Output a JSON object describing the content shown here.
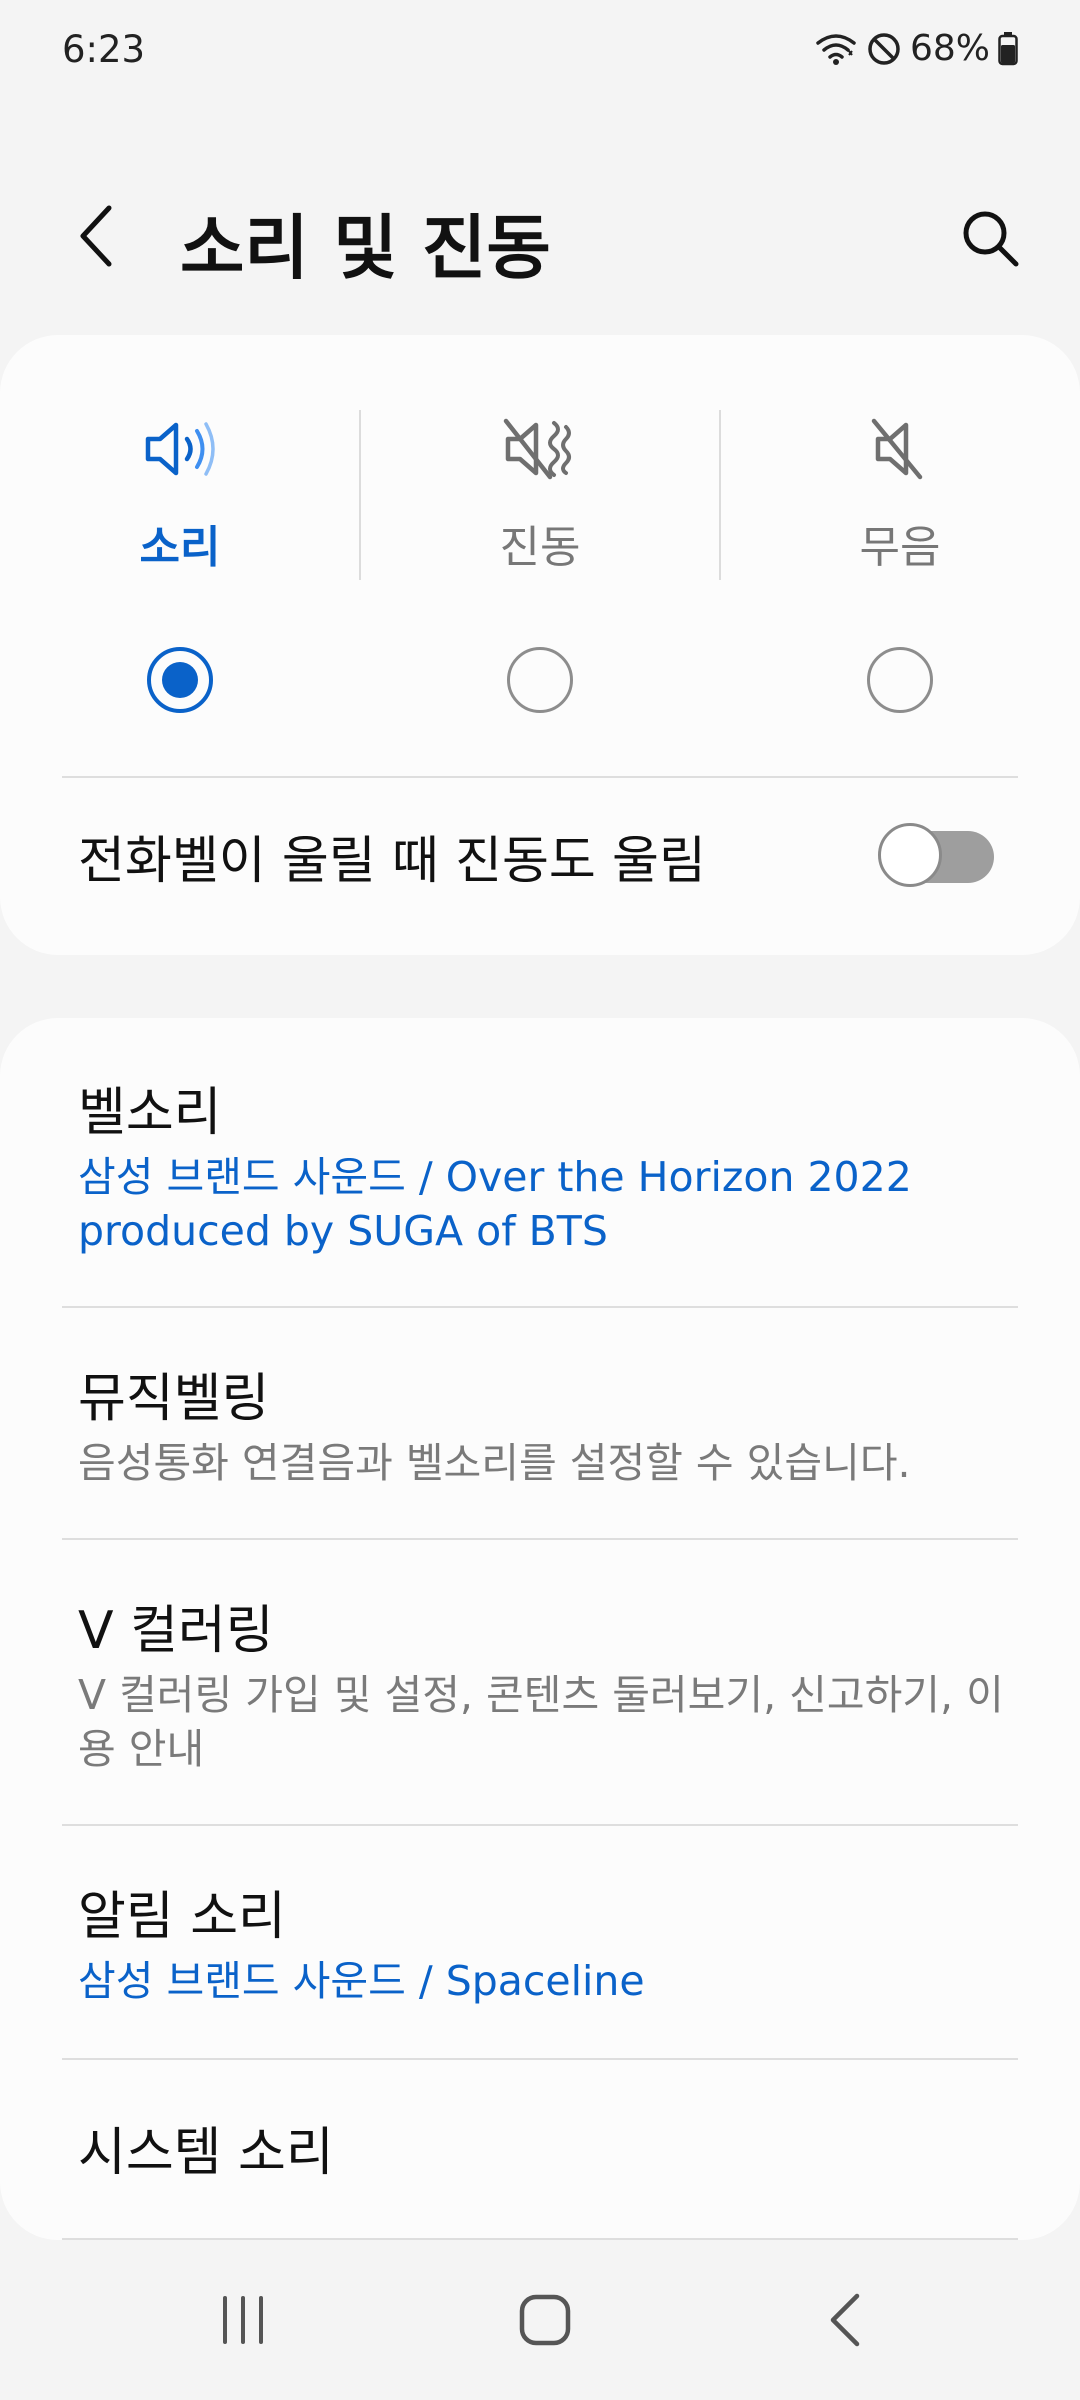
{
  "status_bar": {
    "time": "6:23",
    "battery_percent": "68%",
    "icons": [
      "wifi-icon",
      "do-not-disturb-icon",
      "battery-icon"
    ]
  },
  "header": {
    "title": "소리 및 진동",
    "back_icon": "back-arrow-icon",
    "search_icon": "search-icon"
  },
  "sound_mode": {
    "modes": [
      {
        "label": "소리",
        "icon": "speaker-icon",
        "selected": true
      },
      {
        "label": "진동",
        "icon": "vibrate-icon",
        "selected": false
      },
      {
        "label": "무음",
        "icon": "mute-icon",
        "selected": false
      }
    ],
    "vibrate_while_ringing": {
      "label": "전화벨이 울릴 때 진동도 울림",
      "enabled": false
    }
  },
  "settings": [
    {
      "title": "벨소리",
      "subtitle": "삼성 브랜드 사운드 / Over the Horizon 2022 produced by SUGA of BTS",
      "subtitle_color": "#0a62c9"
    },
    {
      "title": "뮤직벨링",
      "subtitle": "음성통화 연결음과 벨소리를 설정할 수 있습니다.",
      "subtitle_color": "#7a7a7a"
    },
    {
      "title": "V 컬러링",
      "subtitle": "V 컬러링 가입 및 설정, 콘텐츠 둘러보기, 신고하기, 이용 안내",
      "subtitle_color": "#7a7a7a"
    },
    {
      "title": "알림 소리",
      "subtitle": "삼성 브랜드 사운드 / Spaceline",
      "subtitle_color": "#0a62c9"
    },
    {
      "title": "시스템 소리",
      "subtitle": ""
    }
  ],
  "nav_bar": {
    "icons": [
      "recent-apps-icon",
      "home-icon",
      "back-icon"
    ]
  },
  "colors": {
    "accent": "#0a62c9",
    "background": "#f4f4f4",
    "card": "#fcfcfc"
  }
}
